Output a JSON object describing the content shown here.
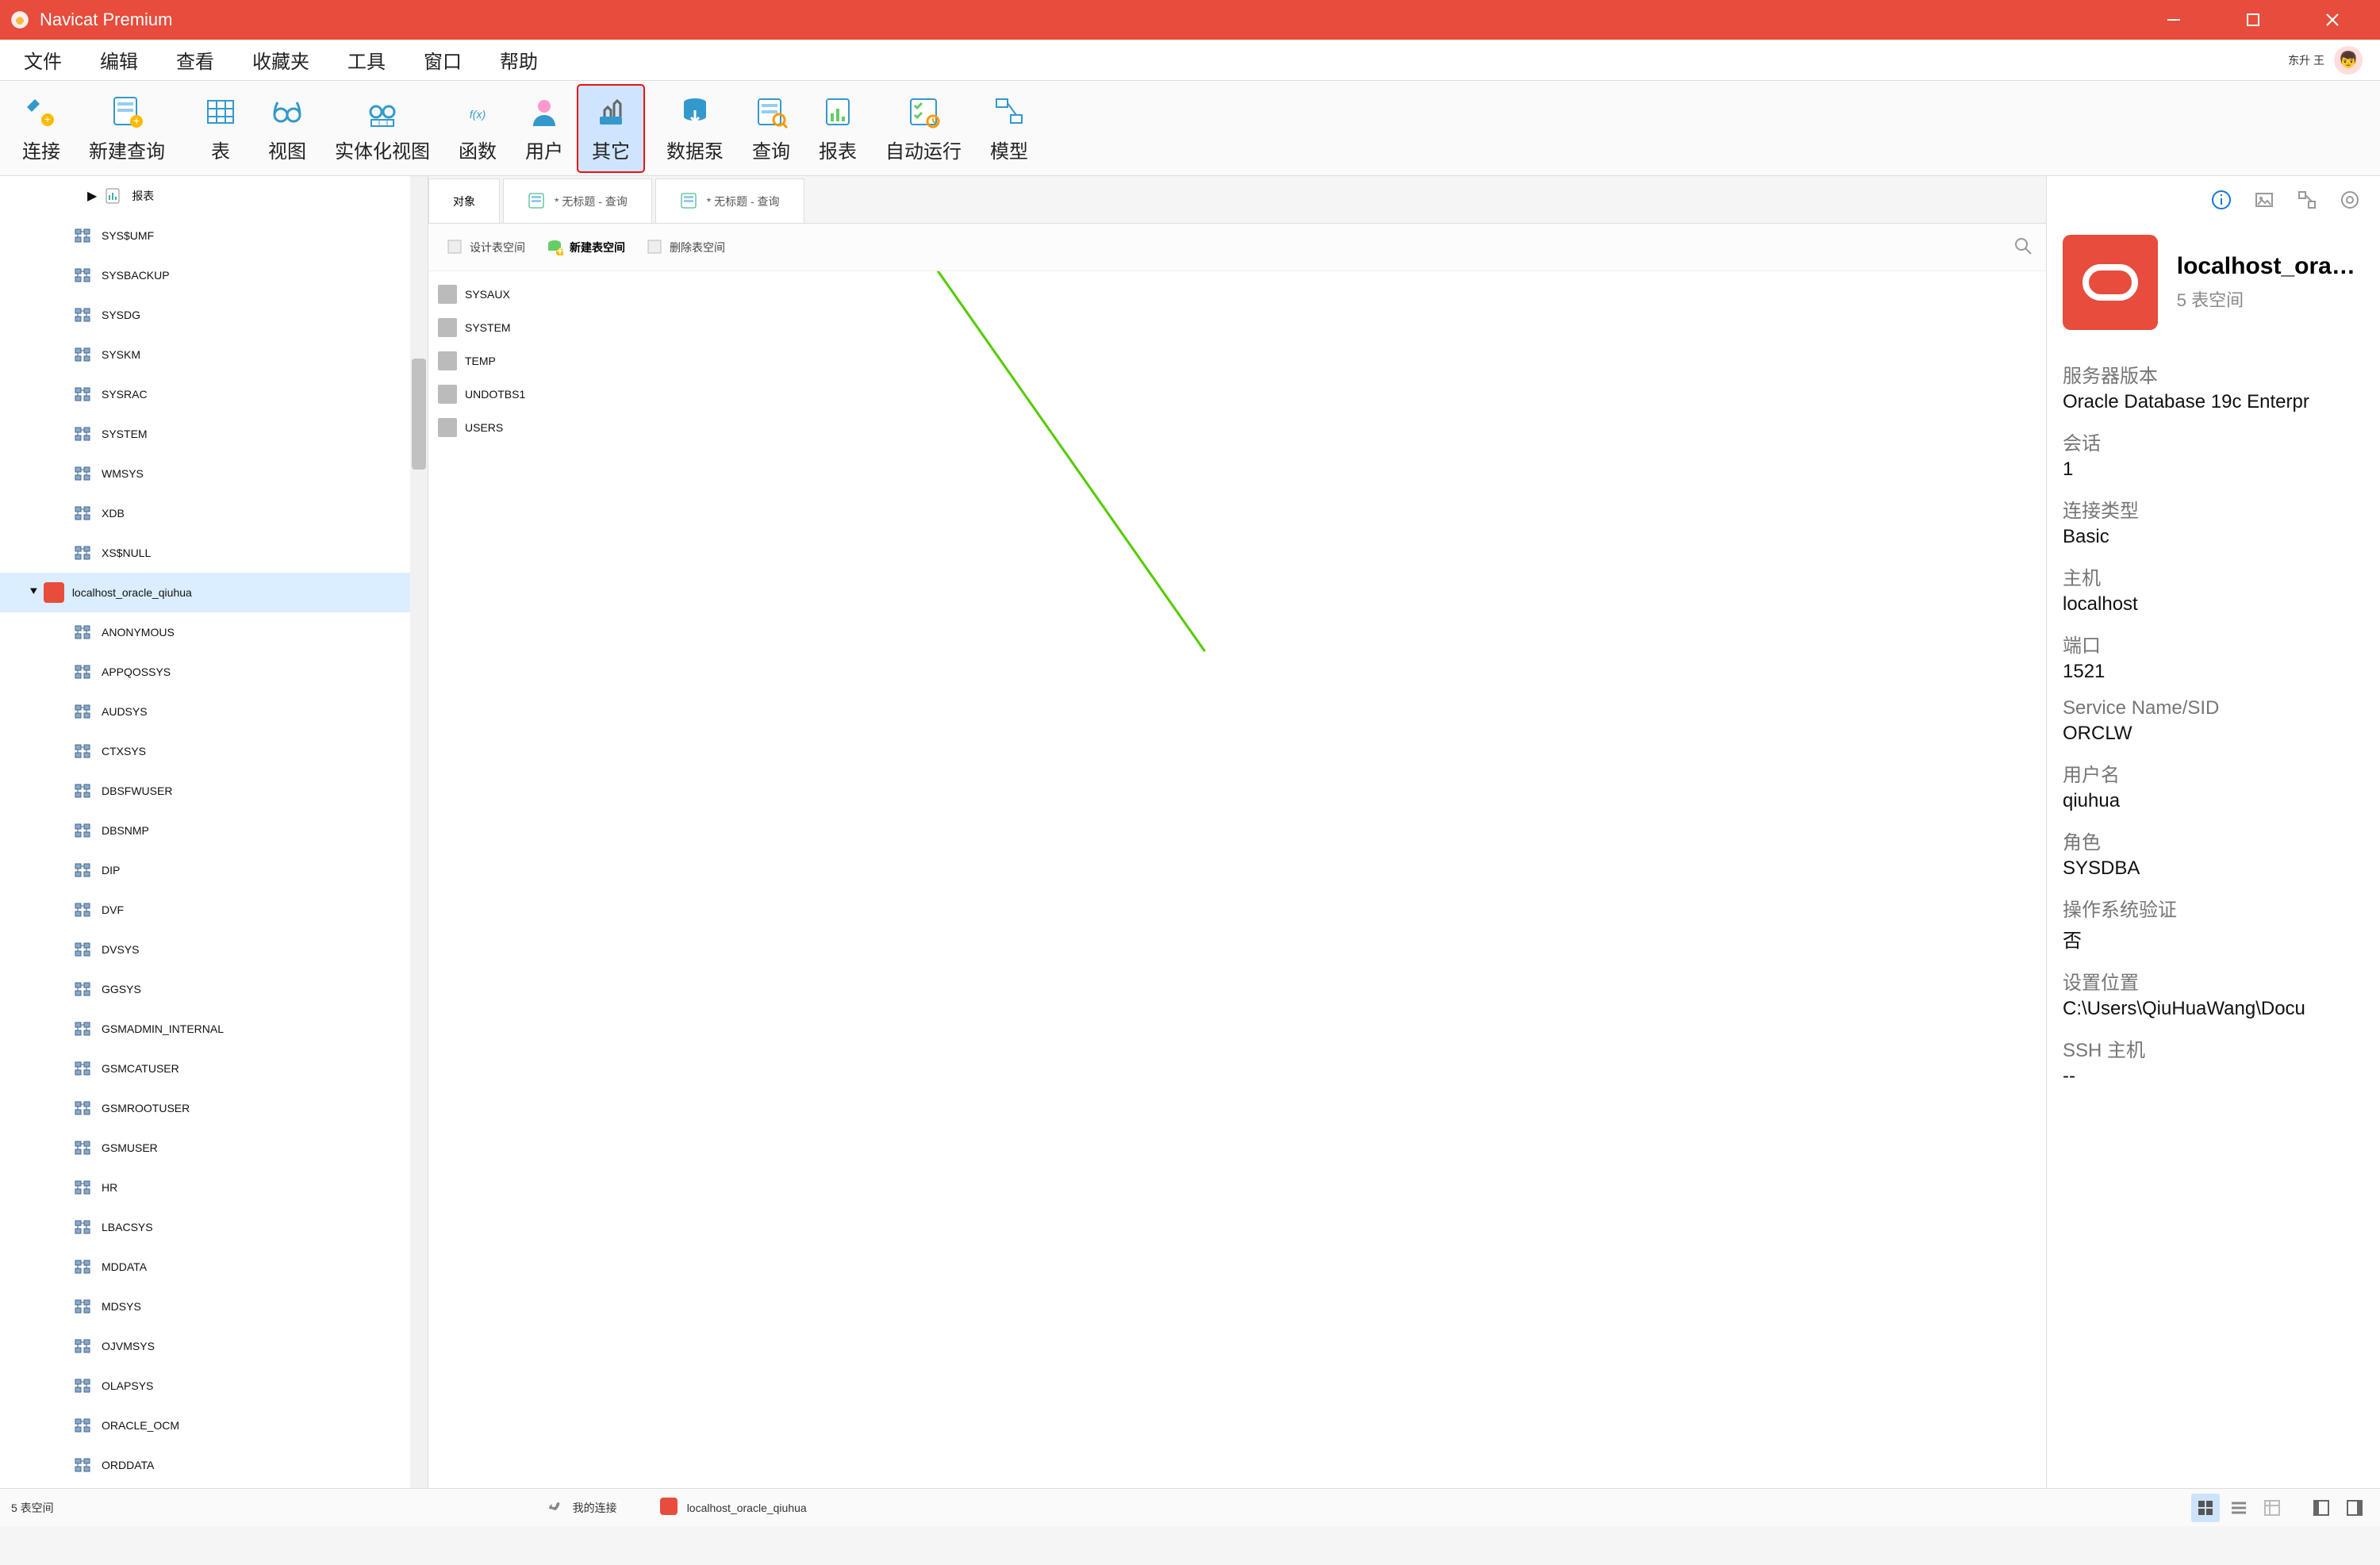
{
  "colors": {
    "brand": "#e74c3c",
    "toolbarActiveBg": "#cfe5ff"
  },
  "titlebar": {
    "title": "Navicat Premium"
  },
  "menubar": {
    "items": [
      "文件",
      "编辑",
      "查看",
      "收藏夹",
      "工具",
      "窗口",
      "帮助"
    ],
    "user": "东升 王"
  },
  "toolbar": [
    {
      "id": "connect",
      "label": "连接",
      "icon": "plug"
    },
    {
      "id": "newquery",
      "label": "新建查询",
      "icon": "sheet-plus"
    },
    {
      "id": "table",
      "label": "表",
      "icon": "grid"
    },
    {
      "id": "view",
      "label": "视图",
      "icon": "glasses"
    },
    {
      "id": "matview",
      "label": "实体化视图",
      "icon": "glasses-grid"
    },
    {
      "id": "function",
      "label": "函数",
      "icon": "fx"
    },
    {
      "id": "user",
      "label": "用户",
      "icon": "person"
    },
    {
      "id": "other",
      "label": "其它",
      "icon": "tools",
      "active": true
    },
    {
      "id": "datapump",
      "label": "数据泵",
      "icon": "db-arrow"
    },
    {
      "id": "query",
      "label": "查询",
      "icon": "sheet-search"
    },
    {
      "id": "report",
      "label": "报表",
      "icon": "chart-doc"
    },
    {
      "id": "autorun",
      "label": "自动运行",
      "icon": "checklist"
    },
    {
      "id": "model",
      "label": "模型",
      "icon": "erd"
    }
  ],
  "tree": {
    "reportsLabel": "报表",
    "topChildren": [
      "SYS$UMF",
      "SYSBACKUP",
      "SYSDG",
      "SYSKM",
      "SYSRAC",
      "SYSTEM",
      "WMSYS",
      "XDB",
      "XS$NULL"
    ],
    "connection": "localhost_oracle_qiuhua",
    "connChildren": [
      "ANONYMOUS",
      "APPQOSSYS",
      "AUDSYS",
      "CTXSYS",
      "DBSFWUSER",
      "DBSNMP",
      "DIP",
      "DVF",
      "DVSYS",
      "GGSYS",
      "GSMADMIN_INTERNAL",
      "GSMCATUSER",
      "GSMROOTUSER",
      "GSMUSER",
      "HR",
      "LBACSYS",
      "MDDATA",
      "MDSYS",
      "OJVMSYS",
      "OLAPSYS",
      "ORACLE_OCM",
      "ORDDATA"
    ]
  },
  "tabs": [
    {
      "id": "objects",
      "label": "对象",
      "active": true
    },
    {
      "id": "q1",
      "label": "* 无标题 - 查询"
    },
    {
      "id": "q2",
      "label": "* 无标题 - 查询"
    }
  ],
  "subbar": {
    "design": "设计表空间",
    "create": "新建表空间",
    "delete": "删除表空间"
  },
  "objects": [
    "SYSAUX",
    "SYSTEM",
    "TEMP",
    "UNDOTBS1",
    "USERS"
  ],
  "info": {
    "name": "localhost_oracle",
    "sub": "5 表空间",
    "pairs": [
      {
        "k": "服务器版本",
        "v": "Oracle Database 19c Enterpr"
      },
      {
        "k": "会话",
        "v": "1"
      },
      {
        "k": "连接类型",
        "v": "Basic"
      },
      {
        "k": "主机",
        "v": "localhost"
      },
      {
        "k": "端口",
        "v": "1521"
      },
      {
        "k": "Service Name/SID",
        "v": "ORCLW"
      },
      {
        "k": "用户名",
        "v": "qiuhua"
      },
      {
        "k": "角色",
        "v": "SYSDBA"
      },
      {
        "k": "操作系统验证",
        "v": "否"
      },
      {
        "k": "设置位置",
        "v": "C:\\Users\\QiuHuaWang\\Docu"
      },
      {
        "k": "SSH 主机",
        "v": "--"
      }
    ]
  },
  "status": {
    "left": "5 表空间",
    "crumb1": "我的连接",
    "crumb2": "localhost_oracle_qiuhua"
  }
}
